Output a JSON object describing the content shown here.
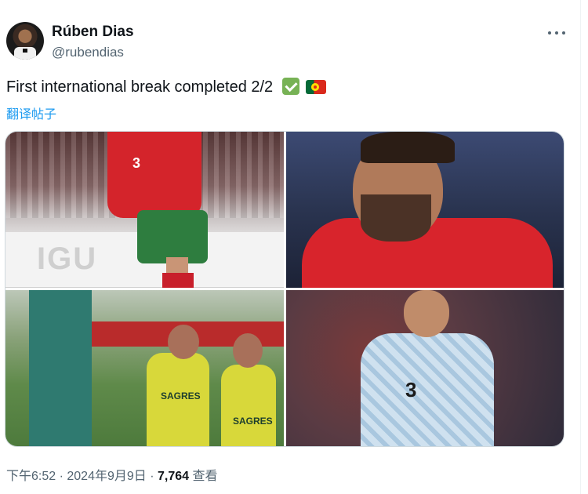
{
  "author": {
    "name": "Rúben Dias",
    "handle": "@rubendias"
  },
  "tweet": {
    "text": "First international break completed 2/2",
    "emojis": [
      "white-heavy-check-mark",
      "flag-portugal"
    ],
    "translate_label": "翻译帖子"
  },
  "media": {
    "photo1_board_text": "IGU",
    "photo1_number": "3",
    "photo3_logo_1": "SAGRES",
    "photo3_logo_2": "SAGRES",
    "photo4_number": "3"
  },
  "meta": {
    "time": "下午6:52",
    "sep1": " · ",
    "date": "2024年9月9日",
    "sep2": " · ",
    "views": "7,764",
    "views_label": " 查看"
  },
  "colors": {
    "link": "#1d9bf0",
    "secondary_text": "#536471"
  },
  "icons": {
    "more": "more-icon",
    "check": "check-icon",
    "flag": "flag-icon"
  }
}
